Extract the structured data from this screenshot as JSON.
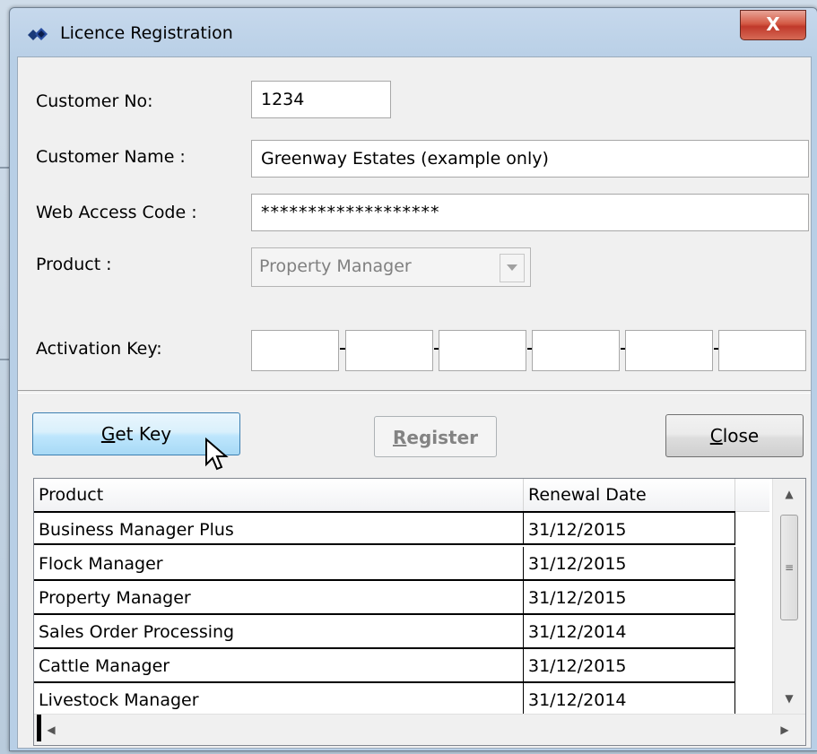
{
  "window": {
    "title": "Licence Registration",
    "close_glyph": "X"
  },
  "form": {
    "customer_no_label": "Customer No:",
    "customer_no_value": "1234",
    "customer_name_label": "Customer Name :",
    "customer_name_value": "Greenway Estates (example only)",
    "web_access_label": "Web Access Code :",
    "web_access_value": "*******************",
    "product_label": "Product :",
    "product_value": "Property Manager",
    "activation_label": "Activation Key:",
    "activation_segments": [
      "",
      "",
      "",
      "",
      "",
      ""
    ]
  },
  "buttons": {
    "get_key_mnemonic": "G",
    "get_key_rest": "et Key",
    "register_mnemonic": "R",
    "register_rest": "egister",
    "close_mnemonic": "C",
    "close_rest": "lose"
  },
  "grid": {
    "columns": [
      "Product",
      "Renewal Date"
    ],
    "rows": [
      [
        "Business Manager Plus",
        "31/12/2015"
      ],
      [
        "Flock Manager",
        "31/12/2015"
      ],
      [
        "Property Manager",
        "31/12/2015"
      ],
      [
        "Sales Order Processing",
        "31/12/2014"
      ],
      [
        "Cattle Manager",
        "31/12/2015"
      ],
      [
        "Livestock Manager",
        "31/12/2014"
      ]
    ]
  },
  "icons": {
    "title": "app-icon",
    "cursor": "mouse-pointer-icon"
  },
  "colors": {
    "title_close": "#c0392b",
    "get_key_border": "#3c7fb1",
    "disabled_text": "#838383"
  }
}
